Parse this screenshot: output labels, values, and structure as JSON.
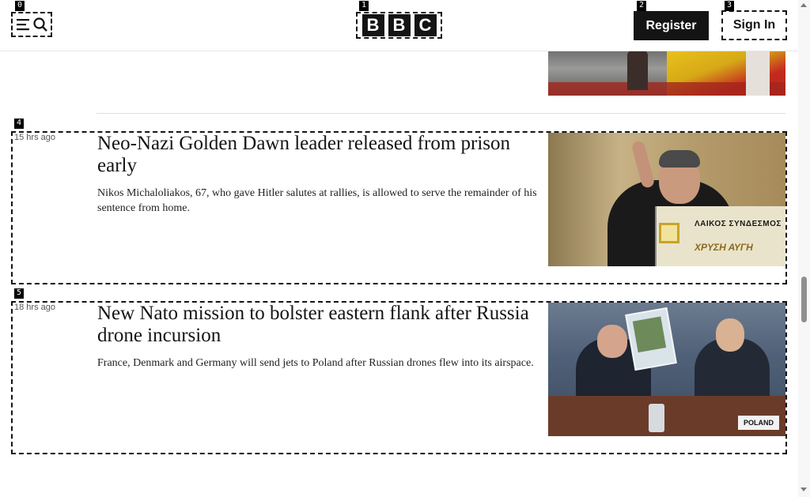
{
  "header": {
    "logo_letters": [
      "B",
      "B",
      "C"
    ],
    "register_label": "Register",
    "signin_label": "Sign In"
  },
  "markers": [
    "0",
    "1",
    "2",
    "3",
    "4",
    "5"
  ],
  "articles": [
    {
      "time": "15 hrs ago",
      "headline": "Neo-Nazi Golden Dawn leader released from prison early",
      "summary": "Nikos Michaloliakos, 67, who gave Hitler salutes at rallies, is allowed to serve the remainder of his sentence from home.",
      "image_text_1": "ΛΑΙΚΟΣ ΣΥΝΔΕΣΜΟΣ",
      "image_text_2": "ΧΡΥΣΗ ΑΥΓΗ"
    },
    {
      "time": "18 hrs ago",
      "headline": "New Nato mission to bolster eastern flank after Russia drone incursion",
      "summary": "France, Denmark and Germany will send jets to Poland after Russian drones flew into its airspace.",
      "image_tag": "POLAND"
    }
  ],
  "icons": {
    "menu": "hamburger-menu-icon",
    "search": "search-icon"
  }
}
